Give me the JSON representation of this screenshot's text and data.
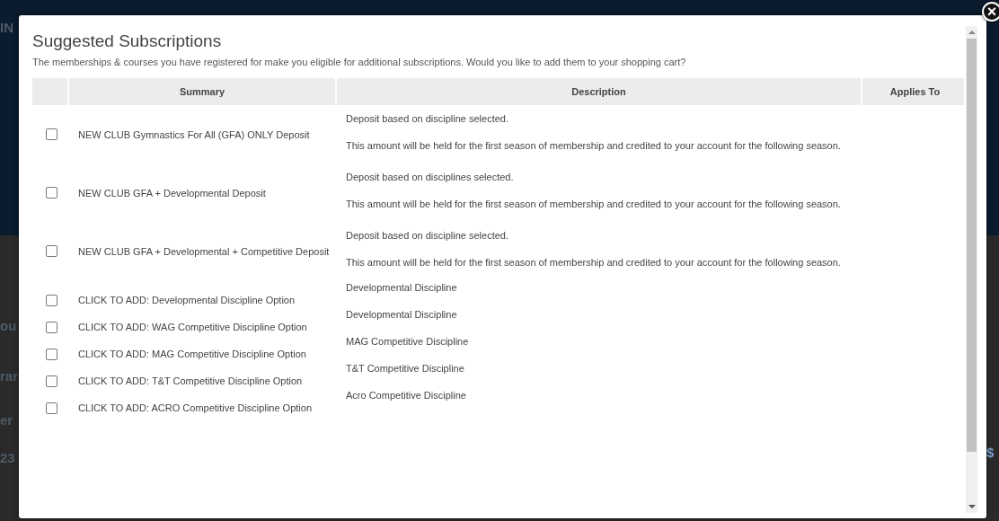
{
  "backdrop": {
    "left_fragments": [
      "IN",
      "ou",
      "rar",
      "er",
      "23"
    ],
    "right_fragments": [
      "$"
    ]
  },
  "dialog": {
    "title": "Suggested Subscriptions",
    "intro": "The memberships & courses you have registered for make you eligible for additional subscriptions. Would you like to add them to your shopping cart?",
    "close_icon": "×",
    "table": {
      "columns": [
        "Summary",
        "Description",
        "Applies To"
      ],
      "rows": [
        {
          "checked": false,
          "summary": "NEW CLUB Gymnastics For All (GFA) ONLY Deposit",
          "description": [
            "Deposit based on discipline selected.",
            "This amount will be held for the first season of membership and credited to your account for the following season."
          ]
        },
        {
          "checked": false,
          "summary": "NEW CLUB GFA + Developmental Deposit",
          "description": [
            "Deposit based on disciplines selected.",
            "This amount will be held for the first season of membership and credited to your account for the following season."
          ]
        },
        {
          "checked": false,
          "summary": "NEW CLUB GFA + Developmental + Competitive Deposit",
          "description": [
            "Deposit based on discipline selected.",
            "This amount will be held for the first season of membership and credited to your account for the following season."
          ]
        },
        {
          "checked": false,
          "summary": "CLICK TO ADD: Developmental Discipline Option",
          "description": [
            "Developmental Discipline"
          ]
        },
        {
          "checked": false,
          "summary": "CLICK TO ADD: WAG Competitive Discipline Option",
          "description": [
            "Developmental Discipline"
          ]
        },
        {
          "checked": false,
          "summary": "CLICK TO ADD: MAG Competitive Discipline Option",
          "description": [
            "MAG Competitive Discipline"
          ]
        },
        {
          "checked": false,
          "summary": "CLICK TO ADD: T&T Competitive Discipline Option",
          "description": [
            "T&T Competitive Discipline"
          ]
        },
        {
          "checked": false,
          "summary": "CLICK TO ADD: ACRO Competitive Discipline Option",
          "description": [
            "Acro Competitive Discipline"
          ]
        }
      ]
    }
  }
}
